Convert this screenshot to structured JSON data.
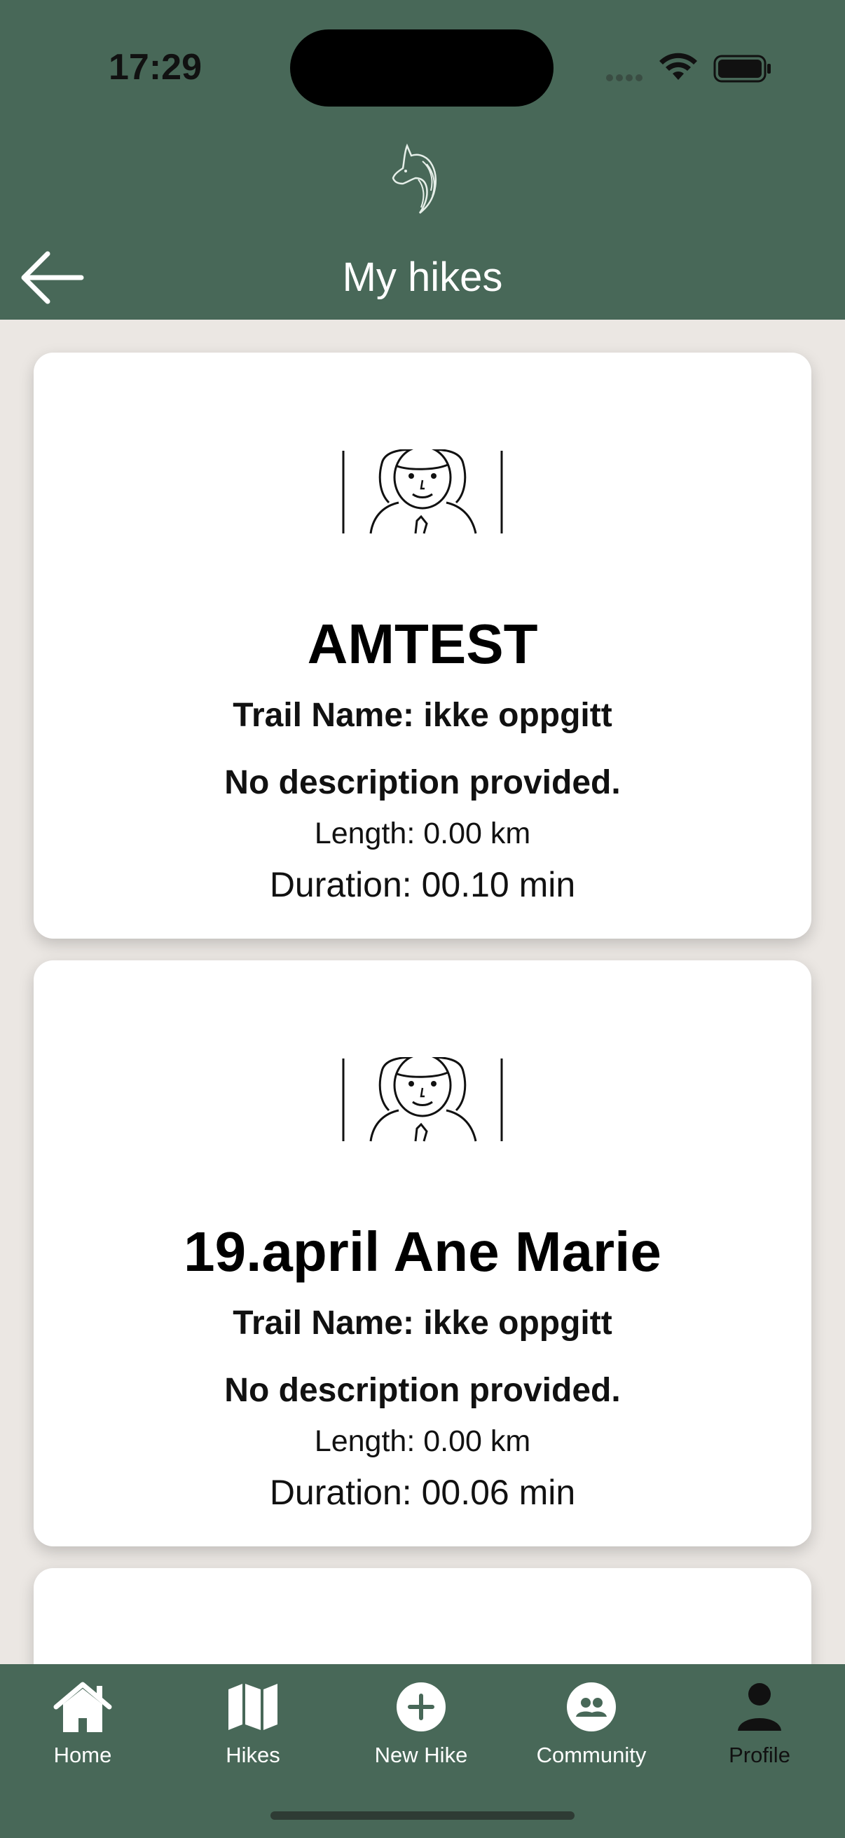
{
  "status_bar": {
    "time": "17:29"
  },
  "header": {
    "title": "My hikes"
  },
  "hikes": [
    {
      "title": "AMTEST",
      "trail": "Trail Name: ikke oppgitt",
      "description": "No description provided.",
      "length": "Length: 0.00 km",
      "duration": "Duration: 00.10 min"
    },
    {
      "title": "19.april Ane Marie",
      "trail": "Trail Name: ikke oppgitt",
      "description": "No description provided.",
      "length": "Length: 0.00 km",
      "duration": "Duration: 00.06 min"
    }
  ],
  "tabbar": {
    "items": [
      {
        "label": "Home",
        "icon": "home-icon"
      },
      {
        "label": "Hikes",
        "icon": "map-icon"
      },
      {
        "label": "New Hike",
        "icon": "plus-circle-icon"
      },
      {
        "label": "Community",
        "icon": "community-icon"
      },
      {
        "label": "Profile",
        "icon": "person-icon"
      }
    ],
    "active": "Profile"
  },
  "colors": {
    "header_bg": "#486858",
    "page_bg": "#ebe7e3",
    "card_bg": "#ffffff"
  }
}
